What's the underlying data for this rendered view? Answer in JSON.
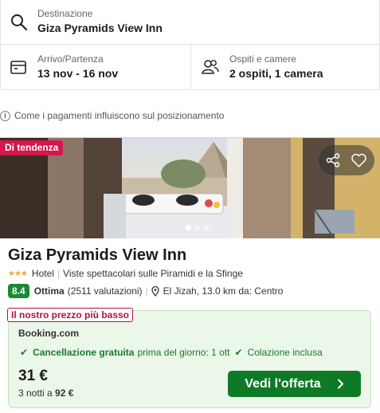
{
  "search": {
    "destination_label": "Destinazione",
    "destination_value": "Giza Pyramids View Inn",
    "dates_label": "Arrivo/Partenza",
    "dates_value": "13 nov - 16 nov",
    "guests_label": "Ospiti e camere",
    "guests_value": "2 ospiti, 1 camera"
  },
  "info_text": "Come i pagamenti influiscono sul posizionamento",
  "listing": {
    "badge": "Di tendenza",
    "name": "Giza Pyramids View Inn",
    "stars": 3,
    "type": "Hotel",
    "highlight": "Viste spettacolari sulle Piramidi e la Sfinge",
    "score": "8.4",
    "score_label": "Ottima",
    "reviews": "(2511 valutazioni)",
    "location": "El Jizah, 13.0 km da: Centro",
    "photo_count": 3,
    "active_photo": 0
  },
  "deal": {
    "tag": "Il nostro prezzo più basso",
    "provider": "Booking.com",
    "perk1_strong": "Cancellazione gratuita",
    "perk1_rest": "prima del giorno: 1 ott",
    "perk2": "Colazione inclusa",
    "price": "31 €",
    "nights_prefix": "3 notti a",
    "nights_total": "92 €",
    "cta": "Vedi l'offerta"
  },
  "icons": {
    "search": "search-icon",
    "calendar": "calendar-icon",
    "guests": "guests-icon",
    "info": "info-icon",
    "share": "share-icon",
    "favorite": "heart-icon",
    "pin": "pin-icon",
    "check": "check-icon",
    "chevron": "chevron-right-icon"
  },
  "colors": {
    "badge": "#d6164c",
    "score": "#1a8a34",
    "cta": "#0f7a26",
    "deal_bg": "#ebf7e8",
    "tag": "#b0124a"
  }
}
